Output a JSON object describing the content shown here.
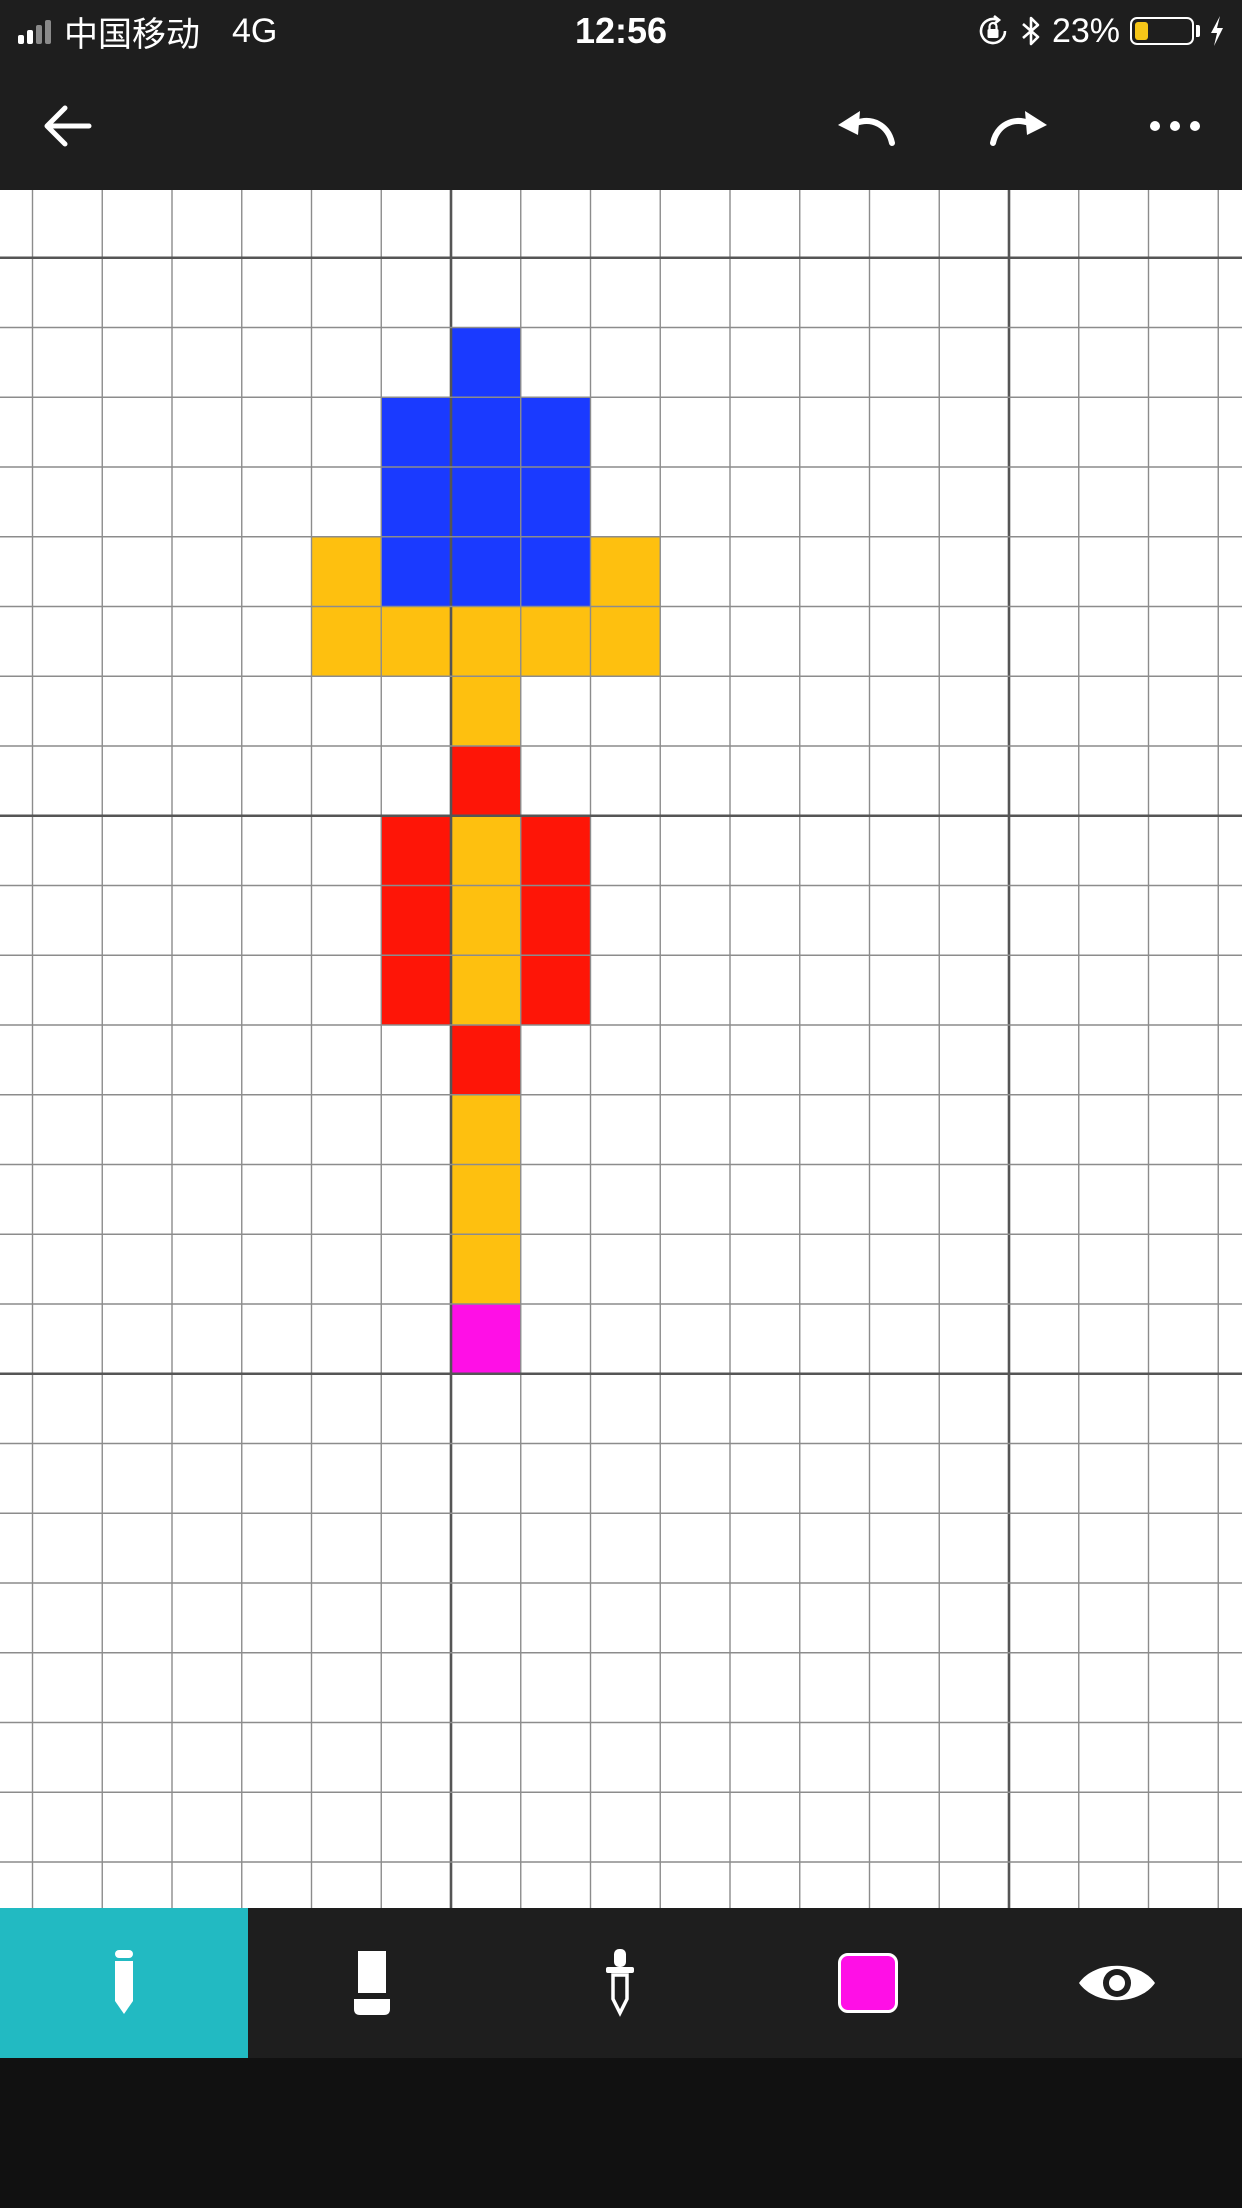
{
  "status_bar": {
    "carrier": "中国移动",
    "network": "4G",
    "time": "12:56",
    "battery_percent": "23%",
    "battery_level": 0.23,
    "icons": [
      "signal-icon",
      "orientation-lock-icon",
      "bluetooth-icon",
      "battery-icon",
      "charging-icon"
    ]
  },
  "toolbar": {
    "icons": [
      "back-arrow-icon",
      "undo-icon",
      "redo-icon",
      "more-icon"
    ]
  },
  "canvas": {
    "columns": 18,
    "rows": 25,
    "major_line_every": 8,
    "colors": {
      "B": "#1a3aff",
      "Y": "#fec00f",
      "R": "#fe1507",
      "M": "#ff0fe6"
    },
    "pixels": [
      {
        "col": 6,
        "row": 2,
        "color": "B"
      },
      {
        "col": 5,
        "row": 3,
        "color": "B"
      },
      {
        "col": 6,
        "row": 3,
        "color": "B"
      },
      {
        "col": 7,
        "row": 3,
        "color": "B"
      },
      {
        "col": 5,
        "row": 4,
        "color": "B"
      },
      {
        "col": 6,
        "row": 4,
        "color": "B"
      },
      {
        "col": 7,
        "row": 4,
        "color": "B"
      },
      {
        "col": 4,
        "row": 5,
        "color": "Y"
      },
      {
        "col": 5,
        "row": 5,
        "color": "B"
      },
      {
        "col": 6,
        "row": 5,
        "color": "B"
      },
      {
        "col": 7,
        "row": 5,
        "color": "B"
      },
      {
        "col": 8,
        "row": 5,
        "color": "Y"
      },
      {
        "col": 4,
        "row": 6,
        "color": "Y"
      },
      {
        "col": 5,
        "row": 6,
        "color": "Y"
      },
      {
        "col": 6,
        "row": 6,
        "color": "Y"
      },
      {
        "col": 7,
        "row": 6,
        "color": "Y"
      },
      {
        "col": 8,
        "row": 6,
        "color": "Y"
      },
      {
        "col": 6,
        "row": 7,
        "color": "Y"
      },
      {
        "col": 6,
        "row": 8,
        "color": "R"
      },
      {
        "col": 5,
        "row": 9,
        "color": "R"
      },
      {
        "col": 6,
        "row": 9,
        "color": "Y"
      },
      {
        "col": 7,
        "row": 9,
        "color": "R"
      },
      {
        "col": 5,
        "row": 10,
        "color": "R"
      },
      {
        "col": 6,
        "row": 10,
        "color": "Y"
      },
      {
        "col": 7,
        "row": 10,
        "color": "R"
      },
      {
        "col": 5,
        "row": 11,
        "color": "R"
      },
      {
        "col": 6,
        "row": 11,
        "color": "Y"
      },
      {
        "col": 7,
        "row": 11,
        "color": "R"
      },
      {
        "col": 6,
        "row": 12,
        "color": "R"
      },
      {
        "col": 6,
        "row": 13,
        "color": "Y"
      },
      {
        "col": 6,
        "row": 14,
        "color": "Y"
      },
      {
        "col": 6,
        "row": 15,
        "color": "Y"
      },
      {
        "col": 6,
        "row": 16,
        "color": "M"
      }
    ]
  },
  "bottom_toolbar": {
    "tools": [
      {
        "name": "pencil-tool",
        "icon": "pencil-icon",
        "active": true
      },
      {
        "name": "eraser-tool",
        "icon": "eraser-icon",
        "active": false
      },
      {
        "name": "eyedropper-tool",
        "icon": "eyedropper-icon",
        "active": false
      },
      {
        "name": "color-swatch",
        "icon": "color-swatch-icon",
        "active": false
      },
      {
        "name": "preview-tool",
        "icon": "eye-icon",
        "active": false
      }
    ],
    "current_color": "#ff0fe6",
    "active_color": "#22bac2"
  }
}
